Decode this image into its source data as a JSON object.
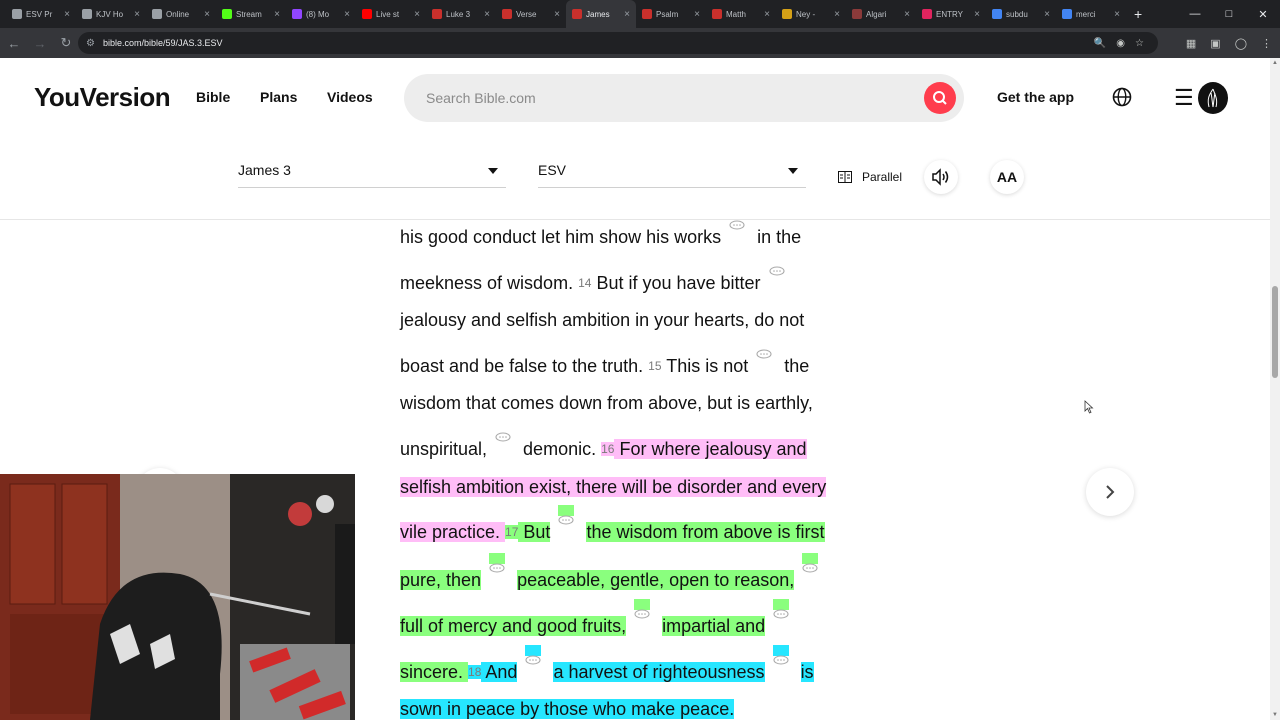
{
  "browser": {
    "tabs": [
      {
        "label": "ESV Pr",
        "fav_color": "#9aa0a6"
      },
      {
        "label": "KJV Ho",
        "fav_color": "#9aa0a6"
      },
      {
        "label": "Online",
        "fav_color": "#9aa0a6"
      },
      {
        "label": "Stream",
        "fav_color": "#53fc18"
      },
      {
        "label": "(8) Mo",
        "fav_color": "#9146ff"
      },
      {
        "label": "Live st",
        "fav_color": "#ff0000"
      },
      {
        "label": "Luke 3",
        "fav_color": "#c9302c"
      },
      {
        "label": "Verse",
        "fav_color": "#c9302c"
      },
      {
        "label": "James",
        "fav_color": "#c9302c",
        "active": true
      },
      {
        "label": "Psalm",
        "fav_color": "#c9302c"
      },
      {
        "label": "Matth",
        "fav_color": "#c9302c"
      },
      {
        "label": "Ney -",
        "fav_color": "#d4a017"
      },
      {
        "label": "Algari",
        "fav_color": "#8b3a3a"
      },
      {
        "label": "ENTRY",
        "fav_color": "#e0245e"
      },
      {
        "label": "subdu",
        "fav_color": "#4285f4"
      },
      {
        "label": "merci",
        "fav_color": "#4285f4"
      }
    ],
    "url": "bible.com/bible/59/JAS.3.ESV"
  },
  "header": {
    "logo": "YouVersion",
    "nav": [
      "Bible",
      "Plans",
      "Videos"
    ],
    "search_placeholder": "Search Bible.com",
    "get_app": "Get the app"
  },
  "toolbar": {
    "book_chapter": "James 3",
    "version": "ESV",
    "parallel": "Parallel",
    "font_button": "AA"
  },
  "reader": {
    "lines": [
      {
        "segments": [
          {
            "t": "his good conduct let him show his works"
          },
          {
            "note": true
          },
          {
            "t": "in the"
          }
        ]
      },
      {
        "segments": [
          {
            "t": "meekness of wisdom. "
          },
          {
            "vn": "14"
          },
          {
            "t": " But if you have bitter"
          },
          {
            "note": true
          }
        ]
      },
      {
        "segments": [
          {
            "t": "jealousy and selfish ambition in your hearts, do not"
          }
        ]
      },
      {
        "segments": [
          {
            "t": "boast and be false to the truth. "
          },
          {
            "vn": "15"
          },
          {
            "t": " This is not"
          },
          {
            "note": true
          },
          {
            "t": "the"
          }
        ]
      },
      {
        "segments": [
          {
            "t": "wisdom that comes down from above, but is earthly,"
          }
        ]
      },
      {
        "segments": [
          {
            "t": "unspiritual,"
          },
          {
            "note": true
          },
          {
            "t": "demonic. "
          },
          {
            "vn": "16",
            "hl": "pink"
          },
          {
            "t": " For where jealousy and",
            "hl": "pink"
          }
        ]
      },
      {
        "segments": [
          {
            "t": "selfish ambition exist, there will be disorder and every",
            "hl": "pink"
          }
        ]
      },
      {
        "segments": [
          {
            "t": "vile practice. ",
            "hl": "pink"
          },
          {
            "vn": "17",
            "hl": "green"
          },
          {
            "t": " But",
            "hl": "green"
          },
          {
            "note": true,
            "hl": "green"
          },
          {
            "t": "the wisdom from above is first",
            "hl": "green"
          }
        ]
      },
      {
        "segments": [
          {
            "t": "pure, then",
            "hl": "green"
          },
          {
            "note": true,
            "hl": "green"
          },
          {
            "t": "peaceable, gentle, open to reason,",
            "hl": "green"
          },
          {
            "note": true,
            "hl": "green"
          }
        ]
      },
      {
        "segments": [
          {
            "t": "full of mercy and good fruits,",
            "hl": "green"
          },
          {
            "note": true,
            "hl": "green"
          },
          {
            "t": "impartial and",
            "hl": "green"
          },
          {
            "note": true,
            "hl": "green"
          }
        ]
      },
      {
        "segments": [
          {
            "t": "sincere. ",
            "hl": "green"
          },
          {
            "vn": "18",
            "hl": "cyan"
          },
          {
            "t": " And",
            "hl": "cyan"
          },
          {
            "note": true,
            "hl": "cyan"
          },
          {
            "t": "a harvest of righteousness",
            "hl": "cyan"
          },
          {
            "note": true,
            "hl": "cyan"
          },
          {
            "t": "is",
            "hl": "cyan"
          }
        ]
      },
      {
        "segments": [
          {
            "t": "sown in peace by those who make peace.",
            "hl": "cyan"
          }
        ]
      }
    ]
  },
  "colors": {
    "accent": "#ff3d4d",
    "highlight_pink": "#ffbdf7",
    "highlight_green": "#8aff7e",
    "highlight_cyan": "#26e6ff"
  }
}
